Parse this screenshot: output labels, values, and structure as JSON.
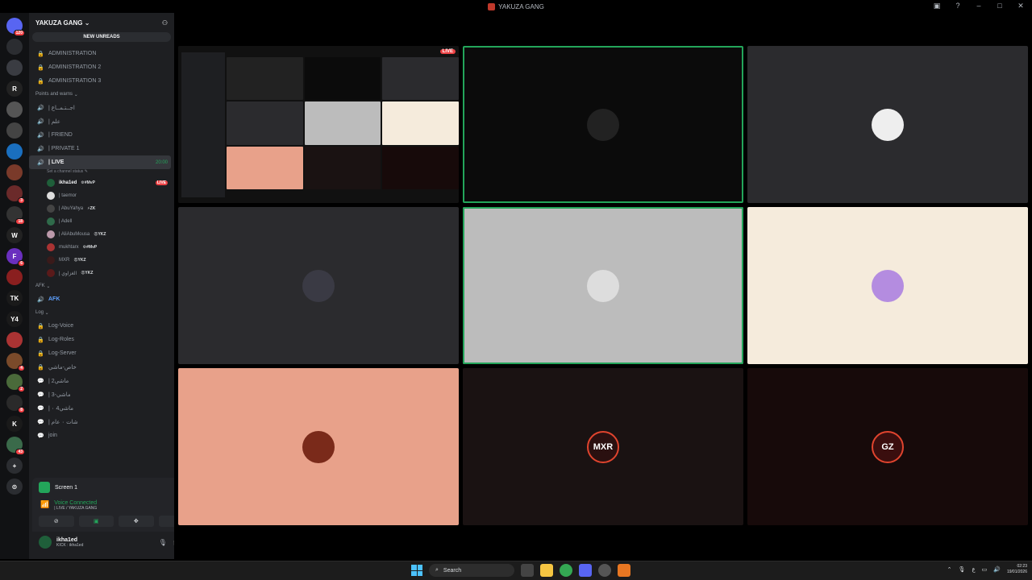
{
  "titlebar": {
    "title": "YAKUZA GANG"
  },
  "servers": [
    {
      "label": "",
      "badge": "120",
      "color": "#5865f2"
    },
    {
      "label": "",
      "badge": "",
      "color": "#2b2d31"
    },
    {
      "label": "",
      "badge": "",
      "color": "#3a3c42"
    },
    {
      "label": "R",
      "badge": "",
      "color": "#222"
    },
    {
      "label": "",
      "badge": "",
      "color": "#555"
    },
    {
      "label": "",
      "badge": "",
      "color": "#444"
    },
    {
      "label": "",
      "badge": "",
      "color": "#1a6fbf"
    },
    {
      "label": "",
      "badge": "",
      "color": "#7a3a2a"
    },
    {
      "label": "",
      "badge": "3",
      "color": "#6b2a2a"
    },
    {
      "label": "",
      "badge": "18",
      "color": "#333"
    },
    {
      "label": "W",
      "badge": "",
      "color": "#222"
    },
    {
      "label": "F",
      "badge": "6",
      "color": "#6a2fbf"
    },
    {
      "label": "",
      "badge": "",
      "color": "#8a1f1f"
    },
    {
      "label": "TK",
      "badge": "",
      "color": "#1a1a1a"
    },
    {
      "label": "Y4",
      "badge": "",
      "color": "#1a1a1a"
    },
    {
      "label": "",
      "badge": "",
      "color": "#a33"
    },
    {
      "label": "",
      "badge": "4",
      "color": "#7a4a2a"
    },
    {
      "label": "",
      "badge": "2",
      "color": "#4a6a3a"
    },
    {
      "label": "",
      "badge": "8",
      "color": "#2a2a2a"
    },
    {
      "label": "K",
      "badge": "",
      "color": "#1a1a1a"
    },
    {
      "label": "",
      "badge": "43",
      "color": "#3a6a4a"
    },
    {
      "label": "+",
      "badge": "",
      "color": "#2b2d31"
    },
    {
      "label": "⊙",
      "badge": "",
      "color": "#2b2d31"
    }
  ],
  "guild": {
    "name": "YAKUZA GANG",
    "new_unreads": "NEW UNREADS",
    "admin_channels": [
      "ADMINISTRATION",
      "ADMINISTRATION 2",
      "ADMINISTRATION 3"
    ],
    "cat_points": "Points and warns",
    "voice_channels": [
      "| اجــتـمــاع",
      "| علم",
      "| FRIEND",
      "| PRIVATE 1"
    ],
    "live_channel": "| LIVE",
    "live_time": "20:00",
    "set_status": "Set a channel status",
    "members": [
      {
        "name": "ikha1ed",
        "tag": "⚙#MvP",
        "live": "LIVE",
        "color": "#1f5f3a"
      },
      {
        "name": "| taemor",
        "tag": "",
        "live": "",
        "color": "#ddd"
      },
      {
        "name": "| AbuYahya",
        "tag": "⚡ZK",
        "live": "",
        "color": "#444"
      },
      {
        "name": "| Adell",
        "tag": "",
        "live": "",
        "color": "#2f6a4a"
      },
      {
        "name": "| AliAbuMousa",
        "tag": "😡YKZ",
        "live": "",
        "color": "#b9a"
      },
      {
        "name": "mukhtarx",
        "tag": "⚙#MvP",
        "live": "",
        "color": "#a33"
      },
      {
        "name": "MXR",
        "tag": "😡YKZ",
        "live": "",
        "color": "#3a1a1a"
      },
      {
        "name": "| الغزاوي",
        "tag": "😡YKZ",
        "live": "",
        "color": "#5a1a1a"
      }
    ],
    "cat_afk": "AFK",
    "afk_channel": "AFK",
    "cat_log": "Log",
    "log_channels": [
      "Log-Voice",
      "Log-Roles",
      "Log-Server",
      "خاص-ماشي",
      "| ماشي2",
      "| ماشي-3",
      "| ماشي4 ٠",
      "| شات ٠ عام",
      "join"
    ]
  },
  "panel": {
    "screen": "Screen 1",
    "voice_connected": "Voice Connected",
    "voice_location": "| LIVE / YAKUZA GANG",
    "username": "ikha1ed",
    "status": "KICK : ikha1ed"
  },
  "tiles": [
    {
      "kind": "screen",
      "bg": "#111111",
      "live": "LIVE"
    },
    {
      "kind": "avatar",
      "bg": "#0b0b0b",
      "avatar_color": "#222",
      "label": "",
      "speaking": true
    },
    {
      "kind": "avatar",
      "bg": "#2b2b2e",
      "avatar_color": "#eee",
      "label": "",
      "speaking": false
    },
    {
      "kind": "avatar",
      "bg": "#2b2b2e",
      "avatar_color": "#3a3a44",
      "label": "",
      "speaking": false
    },
    {
      "kind": "avatar",
      "bg": "#bcbcbc",
      "avatar_color": "#ddd",
      "label": "",
      "speaking": true
    },
    {
      "kind": "avatar",
      "bg": "#f5ebdc",
      "avatar_color": "#b48ce0",
      "label": "",
      "speaking": false
    },
    {
      "kind": "avatar",
      "bg": "#e8a18a",
      "avatar_color": "#7a2a1a",
      "label": "",
      "speaking": false
    },
    {
      "kind": "avatar",
      "bg": "#1a1212",
      "avatar_color": "#2a1010",
      "label": "MXR",
      "speaking": false
    },
    {
      "kind": "avatar",
      "bg": "#170a0a",
      "avatar_color": "#3a0e0e",
      "label": "GZ",
      "speaking": false
    }
  ],
  "taskbar": {
    "search": "Search",
    "lang": "ع",
    "time": "02:23",
    "date": "19/01/2026"
  }
}
